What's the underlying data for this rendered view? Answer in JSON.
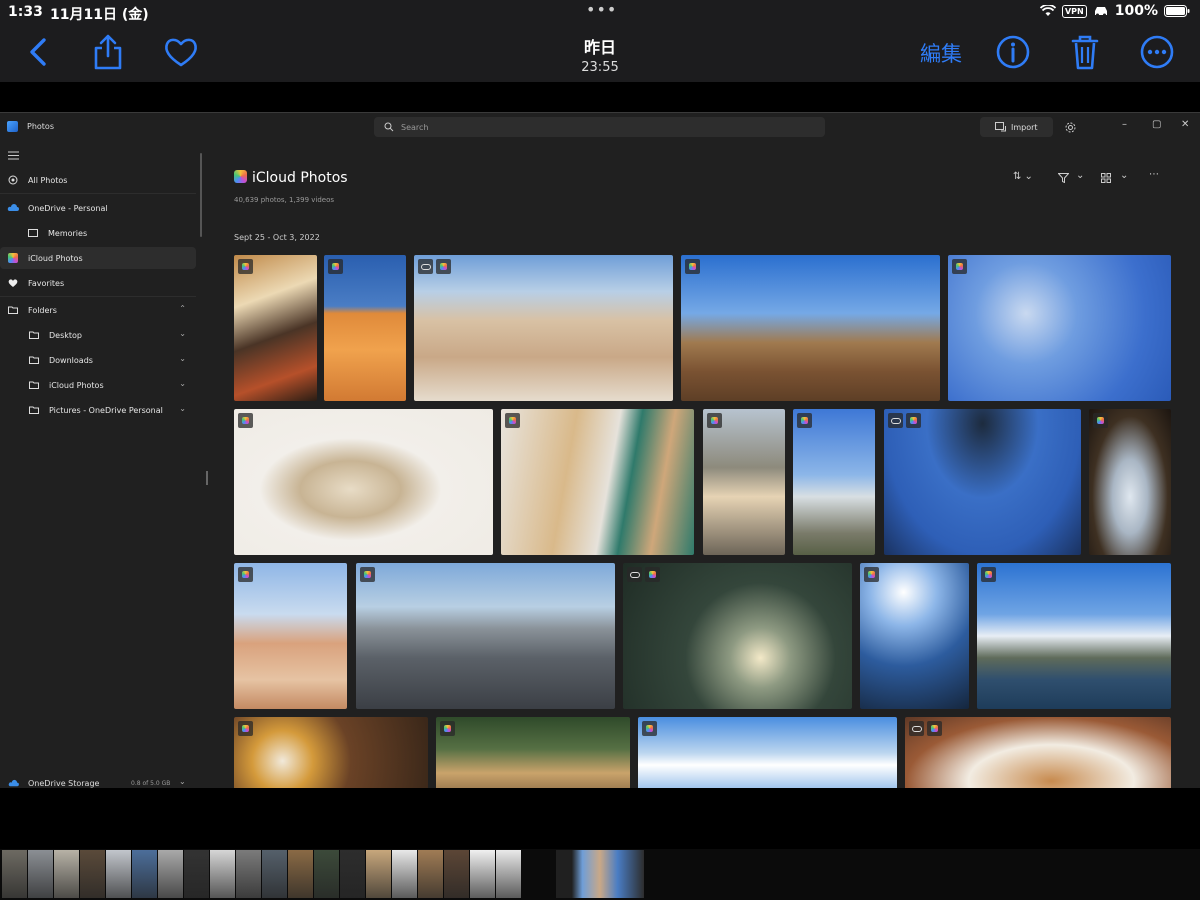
{
  "status_bar": {
    "time": "1:33",
    "date": "11月11日 (金)",
    "vpn": "VPN",
    "battery": "100%"
  },
  "nav": {
    "title": "昨日",
    "subtitle": "23:55",
    "edit_label": "編集",
    "accent": "#2f7cf6"
  },
  "app": {
    "title": "Photos",
    "search_placeholder": "Search",
    "import_label": "Import",
    "sidebar": {
      "all_photos": "All Photos",
      "onedrive": "OneDrive - Personal",
      "memories": "Memories",
      "icloud": "iCloud Photos",
      "favorites": "Favorites",
      "folders": "Folders",
      "desktop": "Desktop",
      "downloads": "Downloads",
      "icloud_folder": "iCloud Photos",
      "pictures": "Pictures - OneDrive Personal"
    },
    "storage": {
      "label": "OneDrive Storage",
      "value": "0.8 of 5.0 GB",
      "fraction": 0.16
    },
    "main": {
      "title": "iCloud Photos",
      "subtitle": "40,639 photos, 1,399 videos",
      "section": "Sept 25 - Oct 3, 2022"
    }
  }
}
